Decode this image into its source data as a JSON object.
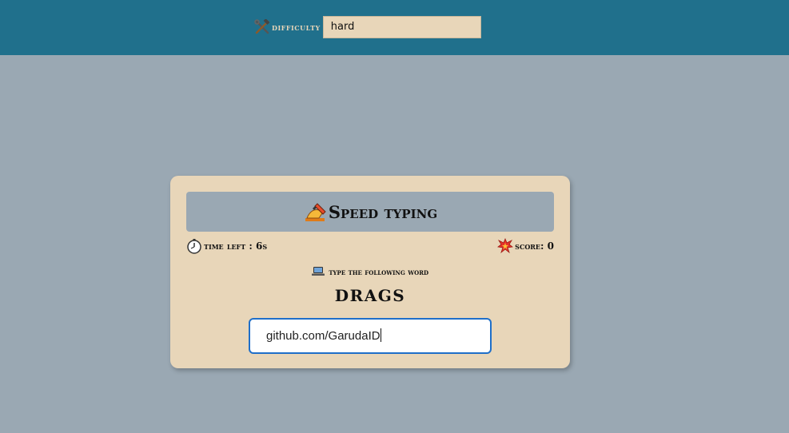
{
  "header": {
    "difficulty_label": "difficulty",
    "difficulty_value": "hard",
    "icons": [
      "hammer-wrench-icon"
    ]
  },
  "game": {
    "title": "Speed typing",
    "time_left_label": "time left : 6s",
    "score_label": "score: 0",
    "instruction": "type the following word",
    "word": "DRAGS",
    "input_value": "github.com/GarudaID",
    "icons": [
      "writing-hand-icon",
      "stopwatch-icon",
      "collision-icon",
      "laptop-icon"
    ]
  },
  "colors": {
    "topbar": "#20708c",
    "background": "#9aa8b3",
    "card": "#e8d6b9",
    "input_focus": "#1f6fc9"
  }
}
